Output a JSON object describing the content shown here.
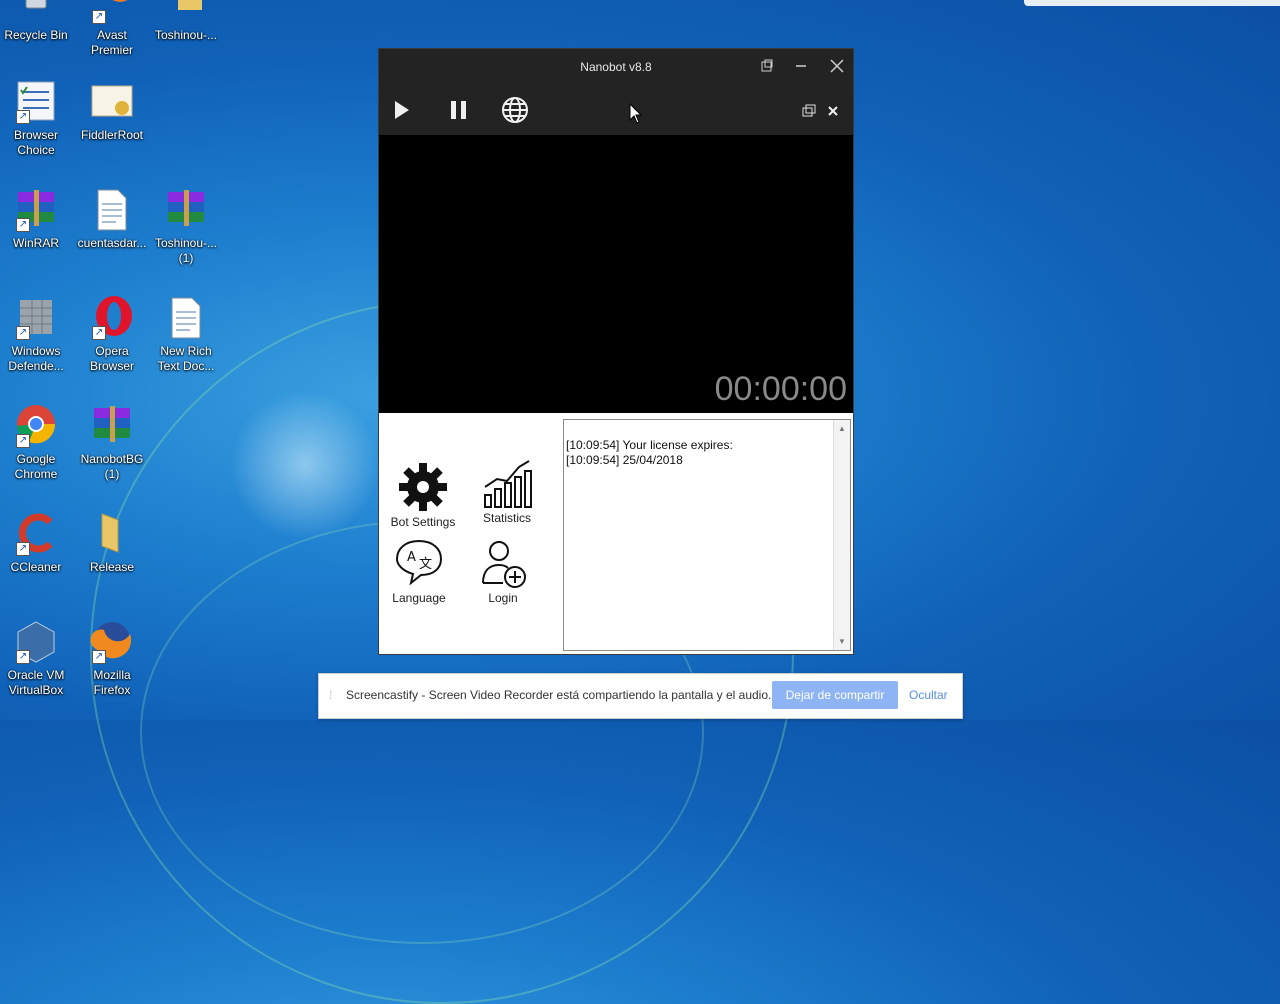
{
  "desktop": {
    "icons": [
      {
        "label": "Recycle Bin",
        "icon": "recycle-bin-icon",
        "shortcut": false
      },
      {
        "label": "Avast Premier",
        "icon": "avast-icon",
        "shortcut": true
      },
      {
        "label": "Toshinou-...",
        "icon": "folder-icon",
        "shortcut": false
      },
      {
        "label": "Browser Choice",
        "icon": "browser-choice-icon",
        "shortcut": true
      },
      {
        "label": "FiddlerRoot",
        "icon": "certificate-icon",
        "shortcut": false
      },
      {
        "label": "WinRAR",
        "icon": "winrar-icon",
        "shortcut": true
      },
      {
        "label": "cuentasdar...",
        "icon": "document-icon",
        "shortcut": false
      },
      {
        "label": "Toshinou-... (1)",
        "icon": "winrar-archive-icon",
        "shortcut": false
      },
      {
        "label": "Windows Defende...",
        "icon": "windows-defender-icon",
        "shortcut": true
      },
      {
        "label": "Opera Browser",
        "icon": "opera-icon",
        "shortcut": true
      },
      {
        "label": "New Rich Text Doc...",
        "icon": "rich-text-document-icon",
        "shortcut": false
      },
      {
        "label": "Google Chrome",
        "icon": "chrome-icon",
        "shortcut": true
      },
      {
        "label": "NanobotBG (1)",
        "icon": "winrar-archive-icon",
        "shortcut": false
      },
      {
        "label": "CCleaner",
        "icon": "ccleaner-icon",
        "shortcut": true
      },
      {
        "label": "Release",
        "icon": "folder-icon",
        "shortcut": false
      },
      {
        "label": "Oracle VM VirtualBox",
        "icon": "virtualbox-icon",
        "shortcut": true
      },
      {
        "label": "Mozilla Firefox",
        "icon": "firefox-icon",
        "shortcut": true
      }
    ]
  },
  "app": {
    "title": "Nanobot v8.8",
    "timer": "00:00:00",
    "tiles": [
      {
        "label": "Bot Settings",
        "icon": "gear-icon"
      },
      {
        "label": "Statistics",
        "icon": "bar-chart-icon"
      },
      {
        "label": "Language",
        "icon": "language-icon"
      },
      {
        "label": "Login",
        "icon": "add-user-icon"
      }
    ],
    "log": [
      "[10:09:54] Your license expires:",
      "[10:09:54] 25/04/2018"
    ]
  },
  "share_bar": {
    "message": "Screencastify - Screen Video Recorder está compartiendo la pantalla y el audio.",
    "stop_label": "Dejar de compartir",
    "hide_label": "Ocultar",
    "accent": "#8fb4f4"
  }
}
